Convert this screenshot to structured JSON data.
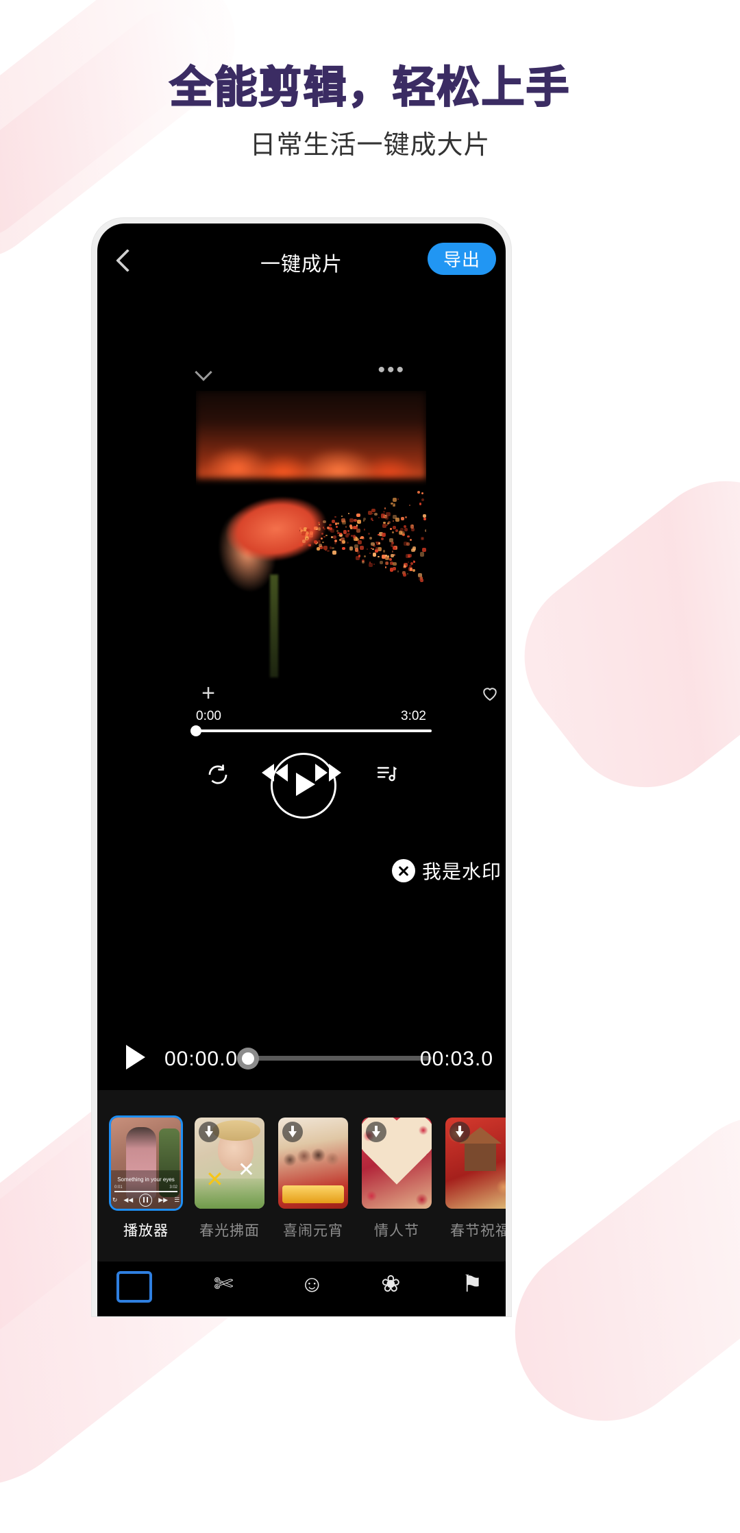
{
  "promo": {
    "headline": "全能剪辑，轻松上手",
    "subhead": "日常生活一键成大片",
    "headline_color": "#3b2c63",
    "ribbon_color": "#fbdee2"
  },
  "app": {
    "nav": {
      "back_icon": "chevron-left-icon",
      "title": "一键成片",
      "export_label": "导出",
      "export_color": "#2196f3"
    },
    "preview": {
      "collapse_icon": "chevron-down-icon",
      "more_icon": "ellipsis-icon",
      "add_icon": "plus-icon",
      "like_icon": "heart-icon",
      "current_time": "0:00",
      "total_time": "3:02",
      "progress_percent": 0,
      "controls": {
        "loop_icon": "loop-icon",
        "prev_icon": "rewind-icon",
        "play_icon": "play-icon",
        "next_icon": "fast-forward-icon",
        "playlist_icon": "playlist-icon"
      },
      "watermark": {
        "text": "我是水印",
        "close_icon": "close-circle-icon"
      }
    },
    "timeline": {
      "play_icon": "play-icon",
      "start_time": "00:00.0",
      "end_time": "00:03.0",
      "scrub_percent": 0
    },
    "templates": [
      {
        "label": "播放器",
        "selected": true,
        "downloadable": false,
        "mini_title": "Something in your eyes",
        "mini_start": "0:01",
        "mini_end": "3:02"
      },
      {
        "label": "春光拂面",
        "selected": false,
        "downloadable": true
      },
      {
        "label": "喜闹元宵",
        "selected": false,
        "downloadable": true
      },
      {
        "label": "情人节",
        "selected": false,
        "downloadable": true
      },
      {
        "label": "春节祝福",
        "selected": false,
        "downloadable": true
      }
    ],
    "toolbar": [
      {
        "icon": "crop-frame-icon"
      },
      {
        "icon": "scissors-icon"
      },
      {
        "icon": "smiley-icon"
      },
      {
        "icon": "sticker-icon"
      },
      {
        "icon": "flag-icon"
      }
    ]
  }
}
